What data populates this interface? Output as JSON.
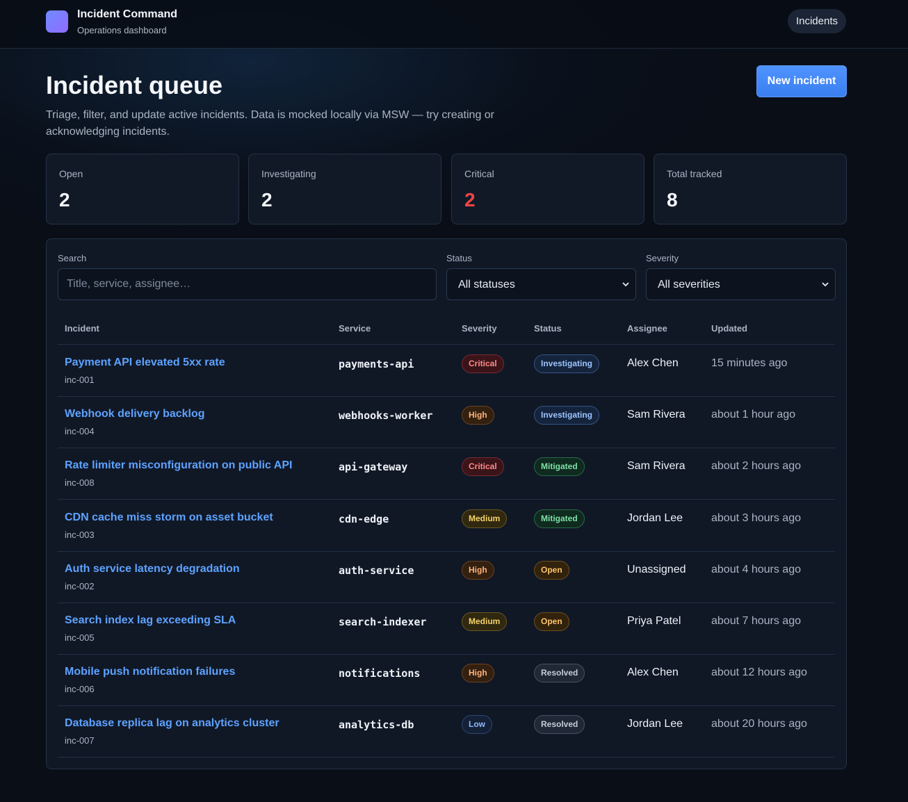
{
  "app": {
    "title": "Incident Command",
    "subtitle": "Operations dashboard",
    "nav_label": "Incidents"
  },
  "header": {
    "title": "Incident queue",
    "description": "Triage, filter, and update active incidents. Data is mocked locally via MSW — try creating or acknowledging incidents.",
    "new_button": "New incident"
  },
  "stats": [
    {
      "label": "Open",
      "value": "2",
      "color": "#f4f7fb"
    },
    {
      "label": "Investigating",
      "value": "2",
      "color": "#f4f7fb"
    },
    {
      "label": "Critical",
      "value": "2",
      "color": "#f04444"
    },
    {
      "label": "Total tracked",
      "value": "8",
      "color": "#f4f7fb"
    }
  ],
  "filters": {
    "search_label": "Search",
    "search_placeholder": "Title, service, assignee…",
    "status_label": "Status",
    "status_value": "All statuses",
    "severity_label": "Severity",
    "severity_value": "All severities"
  },
  "table": {
    "columns": [
      "Incident",
      "Service",
      "Severity",
      "Status",
      "Assignee",
      "Updated"
    ],
    "rows": [
      {
        "title": "Payment API elevated 5xx rate",
        "id": "inc-001",
        "service": "payments-api",
        "severity": "Critical",
        "status": "Investigating",
        "assignee": "Alex Chen",
        "updated": "15 minutes ago"
      },
      {
        "title": "Webhook delivery backlog",
        "id": "inc-004",
        "service": "webhooks-worker",
        "severity": "High",
        "status": "Investigating",
        "assignee": "Sam Rivera",
        "updated": "about 1 hour ago"
      },
      {
        "title": "Rate limiter misconfiguration on public API",
        "id": "inc-008",
        "service": "api-gateway",
        "severity": "Critical",
        "status": "Mitigated",
        "assignee": "Sam Rivera",
        "updated": "about 2 hours ago"
      },
      {
        "title": "CDN cache miss storm on asset bucket",
        "id": "inc-003",
        "service": "cdn-edge",
        "severity": "Medium",
        "status": "Mitigated",
        "assignee": "Jordan Lee",
        "updated": "about 3 hours ago"
      },
      {
        "title": "Auth service latency degradation",
        "id": "inc-002",
        "service": "auth-service",
        "severity": "High",
        "status": "Open",
        "assignee": "Unassigned",
        "updated": "about 4 hours ago"
      },
      {
        "title": "Search index lag exceeding SLA",
        "id": "inc-005",
        "service": "search-indexer",
        "severity": "Medium",
        "status": "Open",
        "assignee": "Priya Patel",
        "updated": "about 7 hours ago"
      },
      {
        "title": "Mobile push notification failures",
        "id": "inc-006",
        "service": "notifications",
        "severity": "High",
        "status": "Resolved",
        "assignee": "Alex Chen",
        "updated": "about 12 hours ago"
      },
      {
        "title": "Database replica lag on analytics cluster",
        "id": "inc-007",
        "service": "analytics-db",
        "severity": "Low",
        "status": "Resolved",
        "assignee": "Jordan Lee",
        "updated": "about 20 hours ago"
      }
    ]
  },
  "badge_colors": {
    "Critical": {
      "fg": "#ff8a8a",
      "bg": "#3a1418",
      "border": "#7a2a30"
    },
    "High": {
      "fg": "#ffb27a",
      "bg": "#33200f",
      "border": "#6e4220"
    },
    "Medium": {
      "fg": "#f4d36a",
      "bg": "#30280f",
      "border": "#6a5a22"
    },
    "Low": {
      "fg": "#8fb8ff",
      "bg": "#132036",
      "border": "#2d4770"
    },
    "Investigating": {
      "fg": "#9cc4ff",
      "bg": "#15243d",
      "border": "#355583"
    },
    "Mitigated": {
      "fg": "#7fe0a8",
      "bg": "#0f2a1f",
      "border": "#2a6a49"
    },
    "Open": {
      "fg": "#ffc36b",
      "bg": "#31220c",
      "border": "#70501d"
    },
    "Resolved": {
      "fg": "#c4ccd8",
      "bg": "#202835",
      "border": "#465366"
    }
  }
}
